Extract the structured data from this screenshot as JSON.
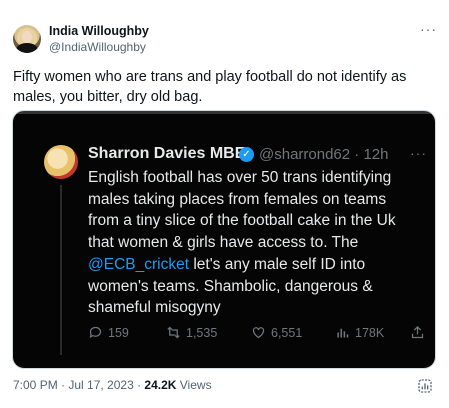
{
  "author": {
    "name": "India Willoughby",
    "handle": "@IndiaWilloughby"
  },
  "more_label": "···",
  "tweet_text": "Fifty women who are trans and play football do not identify as males, you bitter, dry old bag.",
  "quoted": {
    "name": "Sharron Davies MBE",
    "verified_mark": "✓",
    "handle_time": "@sharrond62 · 12h",
    "more_label": "···",
    "lines": [
      "English football has over 50 trans identifying",
      "males taking places from females  on teams",
      "from a tiny slice of the football cake in the Uk",
      "that women & girls have access to. The"
    ],
    "mention": "@ECB_cricket",
    "line5_rest": " let's any male self ID into",
    "lines_after": [
      "women's teams. Shambolic, dangerous &",
      "shameful misogyny"
    ],
    "stats": {
      "replies": "159",
      "reposts": "1,535",
      "likes": "6,551",
      "views": "178K"
    },
    "colors": {
      "accent": "#1d9bf0",
      "background": "#050505"
    }
  },
  "meta": {
    "time_date": "7:00 PM · Jul 17, 2023 · ",
    "views_count": "24.2K",
    "views_label": " Views"
  }
}
